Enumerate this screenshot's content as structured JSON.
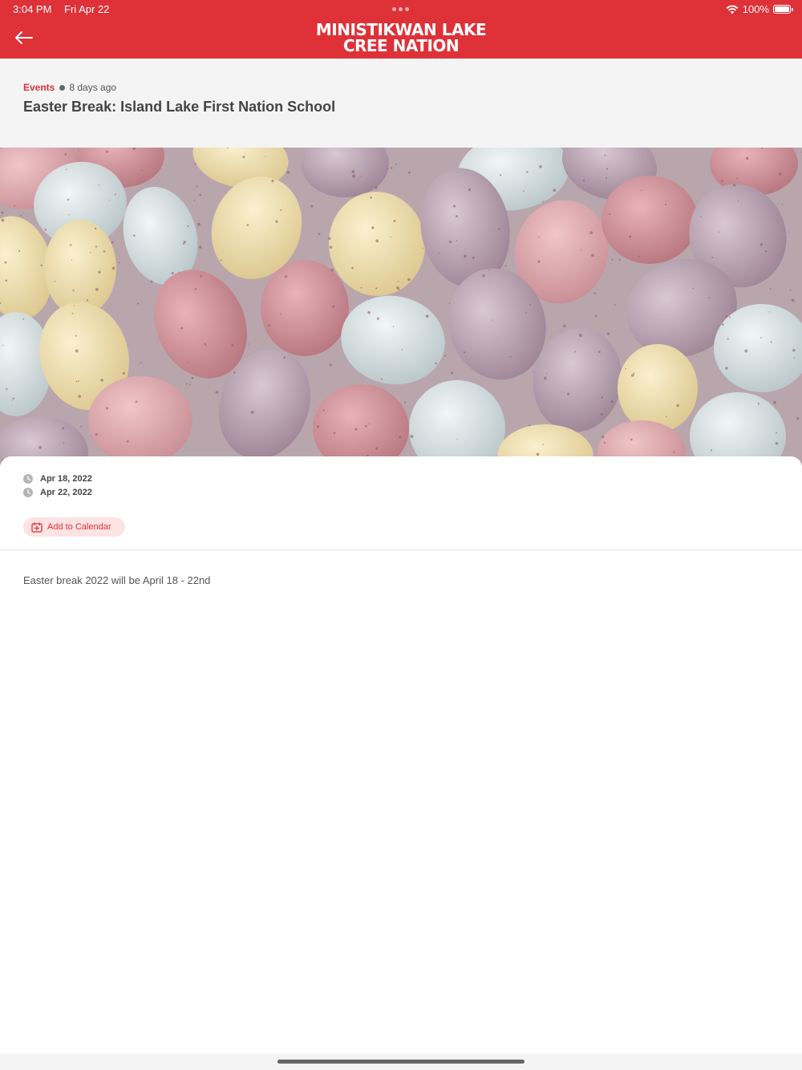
{
  "status_bar": {
    "time": "3:04 PM",
    "date": "Fri Apr 22",
    "battery_text": "100%",
    "battery_level": 1.0
  },
  "app_bar": {
    "back_icon": "arrow-left-icon",
    "logo_line1": "MINISTIKWAN LAKE",
    "logo_line2": "CREE NATION",
    "background_color": "#de3138"
  },
  "article": {
    "category": "Events",
    "posted": "8 days ago",
    "title": "Easter Break: Island Lake First Nation School",
    "hero_image": "pastel-speckled-mini-eggs",
    "start_date": "Apr 18, 2022",
    "end_date": "Apr 22, 2022",
    "date_icon": "clock-icon",
    "calendar_button_label": "Add to Calendar",
    "calendar_icon": "calendar-plus-icon",
    "body": "Easter break 2022 will be April 18 - 22nd"
  },
  "colors": {
    "accent": "#de3138",
    "button_bg": "#fde3e4",
    "header_bg": "#f4f4f4"
  }
}
